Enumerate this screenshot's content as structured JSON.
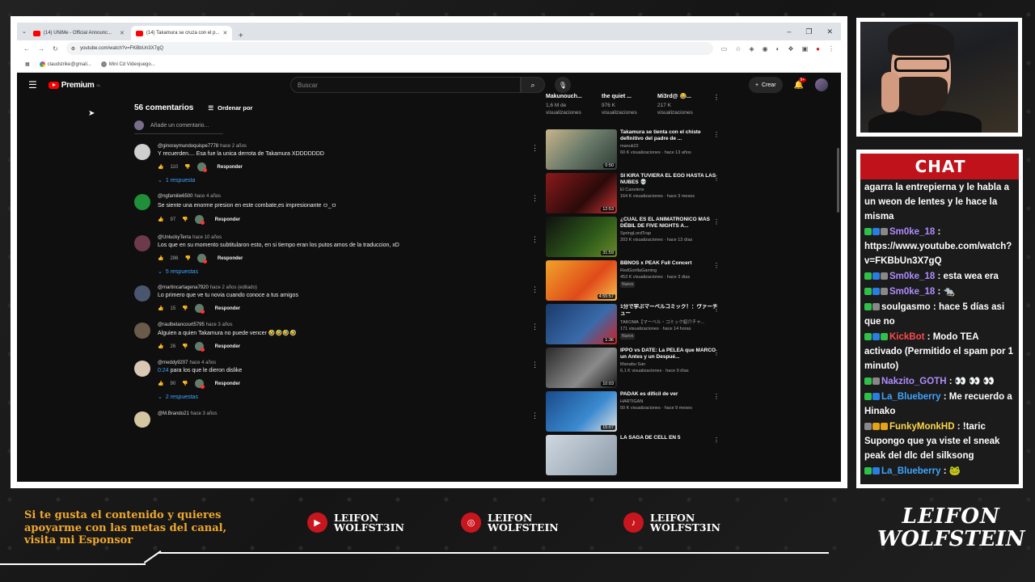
{
  "browser": {
    "tabs": [
      {
        "label": "(14) UNiMe - Official Announc..."
      },
      {
        "label": "(14) Takamura se cruza con el p..."
      }
    ],
    "url": "youtube.com/watch?v=FKBbUn3X7gQ",
    "bookmarks": [
      {
        "label": "claudstrike@gmail..."
      },
      {
        "label": "Mini Cd Videojuego..."
      }
    ]
  },
  "youtube": {
    "logo": "Premium",
    "logo_sup": "CL",
    "search_placeholder": "Buscar",
    "create_label": "Crear",
    "notif_count": "9+",
    "comments_count": "56 comentarios",
    "sort_label": "Ordenar por",
    "add_comment": "Añade un comentario...",
    "reply_label": "Responder",
    "comments": [
      {
        "user": "@ginoraymundoquispe7778",
        "time": "hace 2 años",
        "text": "Y recuerden.... Esa fue la unica derrota de Takamura XDDDDDDD",
        "likes": "110",
        "replies": "1 respuesta",
        "avatar_color": "#cfcfcf"
      },
      {
        "user": "@ngfamilie6500",
        "time": "hace 4 años",
        "text": "Se siente una enorme presion en este combate,es impresionante ㅁ_ㅁ",
        "likes": "97",
        "replies": "",
        "avatar_color": "#1f8f3a"
      },
      {
        "user": "@UnluckyTerra",
        "time": "hace 10 años",
        "text": "Los que en su momento subtitularon esto, en si tiempo eran los putos amos de la traduccion, xD",
        "likes": "286",
        "replies": "5 respuestas",
        "avatar_color": "#6d3a4a"
      },
      {
        "user": "@martincartagena7920",
        "time": "hace 2 años (editado)",
        "text": "Lo primero que ve tu novia cuando conoce a tus amigos",
        "likes": "15",
        "replies": "",
        "avatar_color": "#4a5670"
      },
      {
        "user": "@raulbetancourt5795",
        "time": "hace 3 años",
        "text": "Alguien a quien Takamura no puede vencer 🤣🤣🤣🤣",
        "likes": "26",
        "replies": "",
        "avatar_color": "#6a5a4a"
      },
      {
        "user": "@meddy9207",
        "time": "hace 4 años",
        "text_link": "0:24",
        "text": " para los que le dieron dislike",
        "likes": "90",
        "replies": "2 respuestas",
        "avatar_color": "#d9c8b4"
      },
      {
        "user": "@M.Brando21",
        "time": "hace 3 años",
        "text": "",
        "likes": "",
        "replies": "",
        "avatar_color": "#d4c6a0"
      }
    ],
    "top_recs": [
      {
        "title": "Makunouch...",
        "views": "1,6 M de visualizaciones"
      },
      {
        "title": "the quiet ...",
        "views": "976 K visualizaciones"
      },
      {
        "title": "Mi3rd@ 😂...",
        "views": "217 K visualizaciones"
      }
    ],
    "recs": [
      {
        "title": "Takamura se tienta con el chiste definitivo del padre de ...",
        "channel": "manuk22",
        "stats": "60 K visualizaciones · hace 13 años",
        "duration": "0:50",
        "nuevo": "",
        "thumb": "linear-gradient(135deg,#c8b48a,#6a7a6a 50%,#2e3b35)"
      },
      {
        "title": "SI KIRA TUVIERA EL EGO HASTA LAS NUBES 💀",
        "channel": "El Canolenx",
        "stats": "164 K visualizaciones · hace 3 meses",
        "duration": "12:53",
        "nuevo": "",
        "thumb": "linear-gradient(135deg,#8a1a1a,#2b0a0a 60%,#c33)"
      },
      {
        "title": "¿CUÁL ES EL ANIMATRONICO MÁS DÉBIL DE FIVE NIGHTS A...",
        "channel": "SpringLordTrap",
        "stats": "203 K visualizaciones · hace 13 días",
        "duration": "31:59",
        "nuevo": "",
        "thumb": "linear-gradient(135deg,#101010,#2e5a1a 60%,#6a8a2a)"
      },
      {
        "title": "BBNOS x PEAK Full Concert",
        "channel": "RedGorillaGaming",
        "stats": "453 K visualizaciones · hace 3 días",
        "duration": "4:55:57",
        "nuevo": "Nuevo",
        "thumb": "linear-gradient(135deg,#f0a32a,#e04a1a 60%,#f6c04a)"
      },
      {
        "title": "1分で学ぶマーベルコミック！：ヴァーチュー",
        "channel": "TAKOMA【マーベル・コミック紹介チャ...",
        "stats": "171 visualizaciones · hace 14 horas",
        "duration": "1:36",
        "nuevo": "Nuevo",
        "thumb": "linear-gradient(135deg,#1a3a6a,#3a6aaa 60%,#c22)"
      },
      {
        "title": "IPPO vs DATE: La PELEA que MARCÓ un Antes y un Despué...",
        "channel": "Manabu San",
        "stats": "6,1 K visualizaciones · hace 9 días",
        "duration": "10:03",
        "nuevo": "",
        "thumb": "linear-gradient(135deg,#2a2a2a,#8a8a8a 60%,#1a1a1a)"
      },
      {
        "title": "PADAK es difícil de ver",
        "channel": "HARTIGAN",
        "stats": "50 K visualizaciones · hace 9 meses",
        "duration": "15:07",
        "nuevo": "",
        "thumb": "linear-gradient(135deg,#1a4a8a,#3a8ad0 60%,#e0e0e0)"
      },
      {
        "title": "LA SAGA DE CELL EN 5",
        "channel": "",
        "stats": "",
        "duration": "",
        "nuevo": "",
        "thumb": "linear-gradient(135deg,#d0d8e0,#8a9aa8)"
      }
    ]
  },
  "chat": {
    "title": "CHAT",
    "messages": [
      {
        "user": "",
        "color": "",
        "badges": [],
        "text": "agarra la entrepierna y le habla a un weon de lentes y le hace la misma"
      },
      {
        "user": "Sm0ke_18",
        "color": "#b08cff",
        "badges": [
          "green",
          "blue",
          "gray"
        ],
        "text": "https://www.youtube.com/watch?v=FKBbUn3X7gQ"
      },
      {
        "user": "Sm0ke_18",
        "color": "#b08cff",
        "badges": [
          "green",
          "blue",
          "gray"
        ],
        "text": "esta wea era"
      },
      {
        "user": "Sm0ke_18",
        "color": "#b08cff",
        "badges": [
          "green",
          "blue",
          "gray"
        ],
        "text": "🐀"
      },
      {
        "user": "soulgasmo",
        "color": "#ffffff",
        "badges": [
          "green",
          "gray"
        ],
        "text": "hace 5 días asi que no"
      },
      {
        "user": "KickBot",
        "color": "#ff4a4a",
        "badges": [
          "green",
          "blue",
          "green"
        ],
        "text": "Modo TEA activado (Permitido el spam por 1 minuto)"
      },
      {
        "user": "Nakzito_GOTH",
        "color": "#b08cff",
        "badges": [
          "green",
          "gray"
        ],
        "text": "👀 👀 👀"
      },
      {
        "user": "La_Blueberry",
        "color": "#3ea6ff",
        "badges": [
          "green",
          "blue"
        ],
        "text": "Me recuerdo a Hinako"
      },
      {
        "user": "FunkyMonkHD",
        "color": "#ffd84a",
        "badges": [
          "gray",
          "yellow",
          "yellow"
        ],
        "text": "!taric Supongo que ya viste el sneak peak del dlc del silksong"
      },
      {
        "user": "La_Blueberry",
        "color": "#3ea6ff",
        "badges": [
          "green",
          "blue"
        ],
        "text": "🐸"
      }
    ]
  },
  "overlay": {
    "promo": "Si te gusta el contenido y quieres apoyarme con las metas del canal, visita mi Esponsor",
    "socials": [
      {
        "icon": "youtube-icon",
        "name1": "LEIFON",
        "name2": "WOLFST3IN",
        "glyph": "▶"
      },
      {
        "icon": "instagram-icon",
        "name1": "LEIFON",
        "name2": "WOLFSTEIN",
        "glyph": "◎"
      },
      {
        "icon": "tiktok-icon",
        "name1": "LEIFON",
        "name2": "WOLFST3IN",
        "glyph": "♪"
      }
    ],
    "brand_line1": "LEIFON",
    "brand_line2": "WOLFSTEIN"
  }
}
